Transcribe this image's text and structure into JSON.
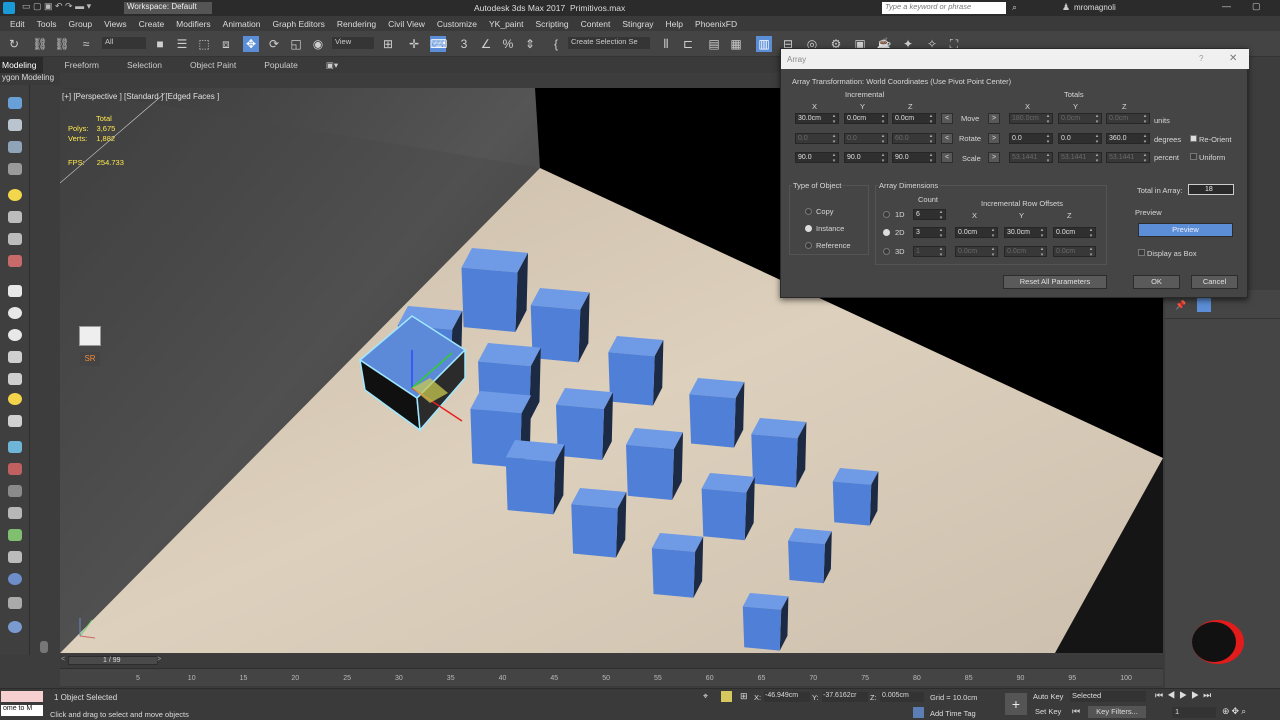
{
  "titlebar": {
    "app_title": "Autodesk 3ds Max 2017",
    "file_name": "Primitivos.max",
    "workspace": "Workspace: Default",
    "search_placeholder": "Type a keyword or phrase",
    "user": "mromagnoli"
  },
  "menu": [
    "Edit",
    "Tools",
    "Group",
    "Views",
    "Create",
    "Modifiers",
    "Animation",
    "Graph Editors",
    "Rendering",
    "Civil View",
    "Customize",
    "YK_paint",
    "Scripting",
    "Content",
    "Stingray",
    "Help",
    "PhoenixFD"
  ],
  "toolbar": {
    "selection_filter": "All",
    "ref_coord": "View",
    "named_selection": "Create Selection Se"
  },
  "ribbon": {
    "tabs": [
      "Modeling",
      "Freeform",
      "Selection",
      "Object Paint",
      "Populate"
    ],
    "sub_label": "ygon Modeling"
  },
  "viewport": {
    "label": "[+] [Perspective ] [Standard ] [Edged Faces ]",
    "stats_total": "Total",
    "polys_label": "Polys:",
    "polys_value": "3,675",
    "verts_label": "Verts:",
    "verts_value": "1,882",
    "fps_label": "FPS:",
    "fps_value": "254.733",
    "sr_label": "SR"
  },
  "dialog": {
    "title": "Array",
    "header": "Array Transformation: World Coordinates (Use Pivot Point Center)",
    "incremental": "Incremental",
    "totals": "Totals",
    "axis_x": "X",
    "axis_y": "Y",
    "axis_z": "Z",
    "move": {
      "label": "Move",
      "inc": [
        "30.0cm",
        "0.0cm",
        "0.0cm"
      ],
      "tot": [
        "180.0cm",
        "0.0cm",
        "0.0cm"
      ],
      "unit": "units"
    },
    "rotate": {
      "label": "Rotate",
      "inc": [
        "0.0",
        "0.0",
        "60.0"
      ],
      "tot": [
        "0.0",
        "0.0",
        "360.0"
      ],
      "unit": "degrees"
    },
    "scale": {
      "label": "Scale",
      "inc": [
        "90.0",
        "90.0",
        "90.0"
      ],
      "tot": [
        "53.1441",
        "53.1441",
        "53.1441"
      ],
      "unit": "percent"
    },
    "reorient": "Re-Orient",
    "uniform": "Uniform",
    "type_of_object": "Type of Object",
    "copy": "Copy",
    "instance": "Instance",
    "reference": "Reference",
    "array_dimensions": "Array Dimensions",
    "count": "Count",
    "row_offsets": "Incremental Row Offsets",
    "d1": {
      "label": "1D",
      "count": "6"
    },
    "d2": {
      "label": "2D",
      "count": "3",
      "x": "0.0cm",
      "y": "30.0cm",
      "z": "0.0cm"
    },
    "d3": {
      "label": "3D",
      "count": "1",
      "x": "0.0cm",
      "y": "0.0cm",
      "z": "0.0cm"
    },
    "total_in_array_label": "Total in Array:",
    "total_in_array": "18",
    "preview_group": "Preview",
    "preview_button": "Preview",
    "display_as_box": "Display as Box",
    "reset": "Reset All Parameters",
    "ok": "OK",
    "cancel": "Cancel"
  },
  "timeline": {
    "frame": "1 / 99",
    "ticks": [
      "5",
      "10",
      "15",
      "20",
      "25",
      "30",
      "35",
      "40",
      "45",
      "50",
      "55",
      "60",
      "65",
      "70",
      "75",
      "80",
      "85",
      "90",
      "95",
      "100"
    ]
  },
  "status": {
    "maxscript": "ome to M",
    "selected": "1 Object Selected",
    "prompt": "Click and drag to select and move objects",
    "x_label": "X:",
    "x_value": "-46.949cm",
    "y_label": "Y:",
    "y_value": "-37.6162cr",
    "z_label": "Z:",
    "z_value": "0.005cm",
    "grid": "Grid = 10.0cm",
    "add_time_tag": "Add Time Tag",
    "auto_key": "Auto Key",
    "set_key": "Set Key",
    "key_mode": "Selected",
    "key_filters": "Key Filters...",
    "current_frame": "1"
  },
  "colors": {
    "cube": "#4f7fd6",
    "floor": "#d8cbb9",
    "selection": "#9fe8ff"
  }
}
